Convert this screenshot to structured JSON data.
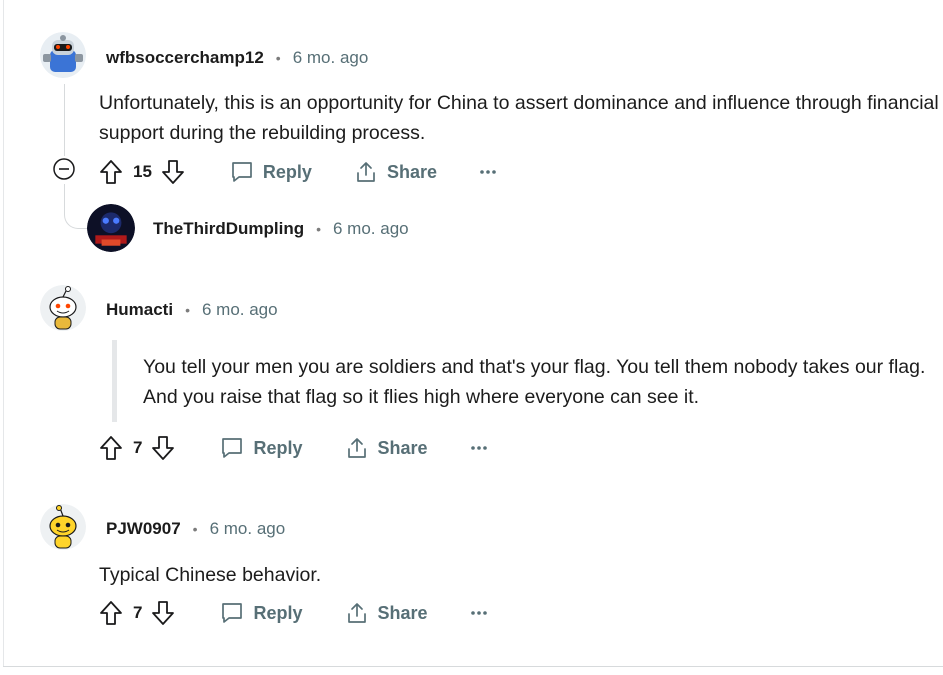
{
  "comments": [
    {
      "username": "wfbsoccerchamp12",
      "time": "6 mo. ago",
      "text": "Unfortunately, this is an opportunity for China to assert dominance and influence through financial support during the rebuilding process.",
      "votes": "15",
      "reply_label": "Reply",
      "share_label": "Share"
    },
    {
      "username": "TheThirdDumpling",
      "time": "6 mo. ago"
    },
    {
      "username": "Humacti",
      "time": "6 mo. ago",
      "text": "You tell your men you are soldiers and that's your flag. You tell them nobody takes our flag. And you raise that flag so it flies high where everyone can see it.",
      "votes": "7",
      "reply_label": "Reply",
      "share_label": "Share"
    },
    {
      "username": "PJW0907",
      "time": "6 mo. ago",
      "text": "Typical Chinese behavior.",
      "votes": "7",
      "reply_label": "Reply",
      "share_label": "Share"
    }
  ],
  "separator": "•",
  "colors": {
    "meta_gray": "#576f76",
    "text": "#1c1c1c",
    "thread_line": "#d7dadc"
  }
}
